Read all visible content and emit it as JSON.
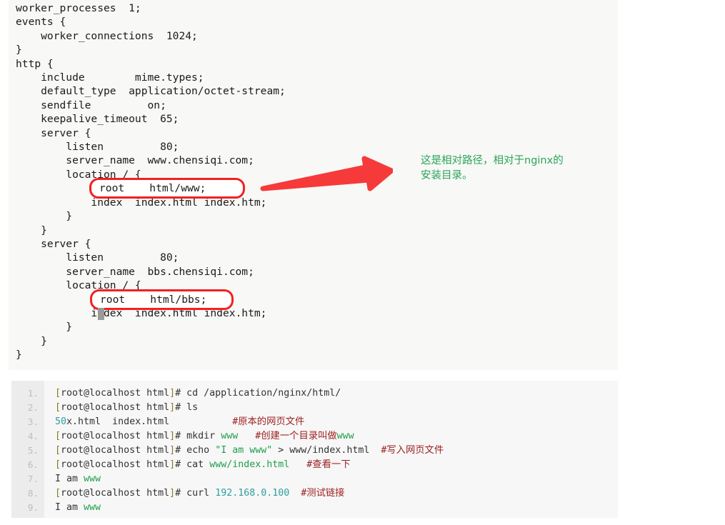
{
  "nginx_config": {
    "language": "nginx",
    "lines": [
      "worker_processes  1;",
      "events {",
      "    worker_connections  1024;",
      "}",
      "http {",
      "    include        mime.types;",
      "    default_type  application/octet-stream;",
      "    sendfile         on;",
      "    keepalive_timeout  65;",
      "    server {",
      "        listen         80;",
      "        server_name  www.chensiqi.com;",
      "        location / {",
      "            root    html/www;",
      "            index  index.html index.htm;",
      "        }",
      "    }",
      "    server {",
      "        listen         80;",
      "        server_name  bbs.chensiqi.com;",
      "        location / {",
      "            root    html/bbs;",
      "            index  index.html index.htm;",
      "        }",
      "    }",
      "}"
    ],
    "text": "worker_processes  1;\nevents {\n    worker_connections  1024;\n}\nhttp {\n    include        mime.types;\n    default_type  application/octet-stream;\n    sendfile         on;\n    keepalive_timeout  65;\n    server {\n        listen         80;\n        server_name  www.chensiqi.com;\n        location / {\n            root    html/www;\n            index  index.html index.htm;\n        }\n    }\n    server {\n        listen         80;\n        server_name  bbs.chensiqi.com;\n        location / {\n            root    html/bbs;\n            index  index.html index.htm;\n        }\n    }\n}"
  },
  "highlights": {
    "box_www_text": "root    html/www;",
    "box_bbs_text": "root    html/bbs;",
    "box_color": "#f42020"
  },
  "annotation": {
    "text": "这是相对路径，相对于nginx的\n安装目录。",
    "color": "#2aa45a"
  },
  "arrow": {
    "color": "#f63a3a",
    "direction": "points-right-up"
  },
  "shell": {
    "prompt": "[root@localhost html]# ",
    "line_numbers": [
      "1.",
      "2.",
      "3.",
      "4.",
      "5.",
      "6.",
      "7.",
      "8.",
      "9."
    ],
    "lines": [
      {
        "n": "1.",
        "segments": [
          {
            "t": "[",
            "c": "br"
          },
          {
            "t": "root@localhost html",
            "c": "pl"
          },
          {
            "t": "]",
            "c": "br"
          },
          {
            "t": "# cd /application/nginx/html/",
            "c": "pl"
          }
        ],
        "plain": "[root@localhost html]# cd /application/nginx/html/"
      },
      {
        "n": "2.",
        "segments": [
          {
            "t": "[",
            "c": "br"
          },
          {
            "t": "root@localhost html",
            "c": "pl"
          },
          {
            "t": "]",
            "c": "br"
          },
          {
            "t": "# ls",
            "c": "pl"
          }
        ],
        "plain": "[root@localhost html]# ls"
      },
      {
        "n": "3.",
        "segments": [
          {
            "t": "50",
            "c": "num"
          },
          {
            "t": "x.html  index.html           ",
            "c": "pl"
          },
          {
            "t": "#原本的网页文件",
            "c": "cmt"
          }
        ],
        "plain": "50x.html  index.html           #原本的网页文件"
      },
      {
        "n": "4.",
        "segments": [
          {
            "t": "[",
            "c": "br"
          },
          {
            "t": "root@localhost html",
            "c": "pl"
          },
          {
            "t": "]",
            "c": "br"
          },
          {
            "t": "# mkdir ",
            "c": "pl"
          },
          {
            "t": "www",
            "c": "str"
          },
          {
            "t": "   ",
            "c": "pl"
          },
          {
            "t": "#创建一个目录叫做",
            "c": "cmt"
          },
          {
            "t": "www",
            "c": "str"
          }
        ],
        "plain": "[root@localhost html]# mkdir www   #创建一个目录叫做www"
      },
      {
        "n": "5.",
        "segments": [
          {
            "t": "[",
            "c": "br"
          },
          {
            "t": "root@localhost html",
            "c": "pl"
          },
          {
            "t": "]",
            "c": "br"
          },
          {
            "t": "# echo ",
            "c": "pl"
          },
          {
            "t": "\"I am www\"",
            "c": "str"
          },
          {
            "t": " > www/index.html  ",
            "c": "pl"
          },
          {
            "t": "#写入网页文件",
            "c": "cmt"
          }
        ],
        "plain": "[root@localhost html]# echo \"I am www\" > www/index.html  #写入网页文件"
      },
      {
        "n": "6.",
        "segments": [
          {
            "t": "[",
            "c": "br"
          },
          {
            "t": "root@localhost html",
            "c": "pl"
          },
          {
            "t": "]",
            "c": "br"
          },
          {
            "t": "# cat ",
            "c": "pl"
          },
          {
            "t": "www/index.html",
            "c": "str"
          },
          {
            "t": "   ",
            "c": "pl"
          },
          {
            "t": "#查看一下",
            "c": "cmt"
          }
        ],
        "plain": "[root@localhost html]# cat www/index.html   #查看一下"
      },
      {
        "n": "7.",
        "segments": [
          {
            "t": "I am ",
            "c": "pl"
          },
          {
            "t": "www",
            "c": "str"
          }
        ],
        "plain": "I am www"
      },
      {
        "n": "8.",
        "segments": [
          {
            "t": "[",
            "c": "br"
          },
          {
            "t": "root@localhost html",
            "c": "pl"
          },
          {
            "t": "]",
            "c": "br"
          },
          {
            "t": "# curl ",
            "c": "pl"
          },
          {
            "t": "192.168.0.100",
            "c": "num"
          },
          {
            "t": "  ",
            "c": "pl"
          },
          {
            "t": "#测试链接",
            "c": "cmt"
          }
        ],
        "plain": "[root@localhost html]# curl 192.168.0.100  #测试链接"
      },
      {
        "n": "9.",
        "segments": [
          {
            "t": "I am ",
            "c": "pl"
          },
          {
            "t": "www",
            "c": "str"
          }
        ],
        "plain": "I am www"
      }
    ]
  },
  "colors": {
    "code_bg": "#f8f8f6",
    "shell_bg": "#f7f7f7",
    "shell_gutter_bg": "#ececec",
    "linenumber": "#bdbdbd",
    "string": "#1f9e4a",
    "number": "#2f9e9e",
    "comment": "#9c1f1f",
    "bracket": "#8a7b20",
    "text": "#333333"
  }
}
